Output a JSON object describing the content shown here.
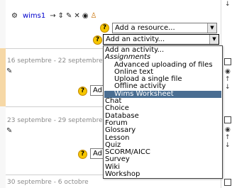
{
  "colors": {
    "left_strip_top": "#f7f7f7",
    "left_strip_highlight": "#f6d8a6",
    "divider": "#cfcfcf",
    "dropdown_selected": "#4a6e92",
    "link": "#0000cc"
  },
  "top_section": {
    "link_label": "wims1",
    "tool_icons": [
      "move-arrow-icon",
      "move-icon",
      "edit-icon",
      "delete-icon",
      "eye-icon",
      "user-icon"
    ],
    "resource_select": {
      "value": "Add a resource..."
    },
    "activity_select": {
      "value": "Add an activity..."
    }
  },
  "weeks": [
    {
      "title": "16 septembre - 22 septembre",
      "select_visible_text": "Ad"
    },
    {
      "title": "23 septembre - 29 septembre",
      "select_visible_text": "Ad"
    },
    {
      "title": "30 septembre - 6 octobre"
    }
  ],
  "activity_dropdown": {
    "options": [
      {
        "label": "Add an activity...",
        "kind": "option"
      },
      {
        "label": "Assignments",
        "kind": "group"
      },
      {
        "label": "Advanced uploading of files",
        "kind": "child"
      },
      {
        "label": "Online text",
        "kind": "child"
      },
      {
        "label": "Upload a single file",
        "kind": "child"
      },
      {
        "label": "Offline activity",
        "kind": "child"
      },
      {
        "label": "Wims Worksheet",
        "kind": "child",
        "selected": true
      },
      {
        "label": "Chat",
        "kind": "option"
      },
      {
        "label": "Choice",
        "kind": "option"
      },
      {
        "label": "Database",
        "kind": "option"
      },
      {
        "label": "Forum",
        "kind": "option"
      },
      {
        "label": "Glossary",
        "kind": "option"
      },
      {
        "label": "Lesson",
        "kind": "option"
      },
      {
        "label": "Quiz",
        "kind": "option"
      },
      {
        "label": "SCORM/AICC",
        "kind": "option"
      },
      {
        "label": "Survey",
        "kind": "option"
      },
      {
        "label": "Wiki",
        "kind": "option"
      },
      {
        "label": "Workshop",
        "kind": "option"
      }
    ]
  }
}
